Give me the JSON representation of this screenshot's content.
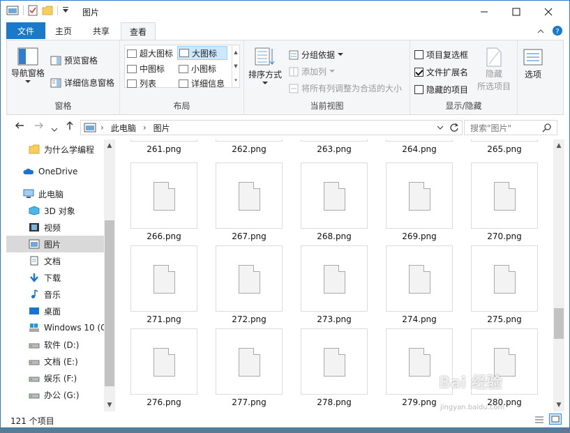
{
  "window": {
    "title": "图片",
    "minimize": "—",
    "maximize": "☐",
    "close": "✕"
  },
  "menu": {
    "file": "文件",
    "home": "主页",
    "share": "共享",
    "view": "查看"
  },
  "ribbon": {
    "pane": {
      "nav_pane": "导航窗格",
      "preview_pane": "预览窗格",
      "details_pane": "详细信息窗格",
      "label": "窗格"
    },
    "layout": {
      "extra_large": "超大图标",
      "large": "大图标",
      "medium": "中图标",
      "small": "小图标",
      "list": "列表",
      "details": "详细信息",
      "label": "布局"
    },
    "current_view": {
      "sort_by": "排序方式",
      "group_by": "分组依据",
      "add_columns": "添加列",
      "size_all_columns": "将所有列调整为合适的大小",
      "label": "当前视图"
    },
    "show_hide": {
      "item_checkboxes": "项目复选框",
      "file_extensions": "文件扩展名",
      "hidden_items": "隐藏的项目",
      "hide": "隐藏",
      "hide_selected": "所选项目",
      "label": "显示/隐藏"
    },
    "options": {
      "label": "选项"
    }
  },
  "address": {
    "this_pc": "此电脑",
    "current": "图片",
    "search_placeholder": "搜索\"图片\""
  },
  "nav": [
    {
      "label": "为什么学编程",
      "icon": "folder-icon"
    },
    {
      "label": "OneDrive",
      "icon": "cloud-icon"
    },
    {
      "label": "此电脑",
      "icon": "computer-icon"
    },
    {
      "label": "3D 对象",
      "icon": "cube-icon"
    },
    {
      "label": "视频",
      "icon": "video-icon"
    },
    {
      "label": "图片",
      "icon": "pictures-icon",
      "selected": true
    },
    {
      "label": "文档",
      "icon": "document-icon"
    },
    {
      "label": "下载",
      "icon": "download-icon"
    },
    {
      "label": "音乐",
      "icon": "music-icon"
    },
    {
      "label": "桌面",
      "icon": "desktop-icon"
    },
    {
      "label": "Windows 10 (C",
      "icon": "windows-drive-icon"
    },
    {
      "label": "软件 (D:)",
      "icon": "drive-icon"
    },
    {
      "label": "文档 (E:)",
      "icon": "drive-icon"
    },
    {
      "label": "娱乐 (F:)",
      "icon": "drive-icon"
    },
    {
      "label": "办公 (G:)",
      "icon": "drive-icon"
    }
  ],
  "files": {
    "top_partial": [
      "261.png",
      "262.png",
      "263.png",
      "264.png",
      "265.png"
    ],
    "rows": [
      [
        "266.png",
        "267.png",
        "268.png",
        "269.png",
        "270.png"
      ],
      [
        "271.png",
        "272.png",
        "273.png",
        "274.png",
        "275.png"
      ],
      [
        "276.png",
        "277.png",
        "278.png",
        "279.png",
        "280.png"
      ]
    ]
  },
  "status": {
    "count": "121 个项目"
  },
  "watermark": {
    "main": "Bai 经验",
    "sub": "jingyan.baidu.com"
  },
  "colors": {
    "accent": "#1979ca",
    "selection": "#cce8ff",
    "nav_selected": "#d9d9d9"
  }
}
